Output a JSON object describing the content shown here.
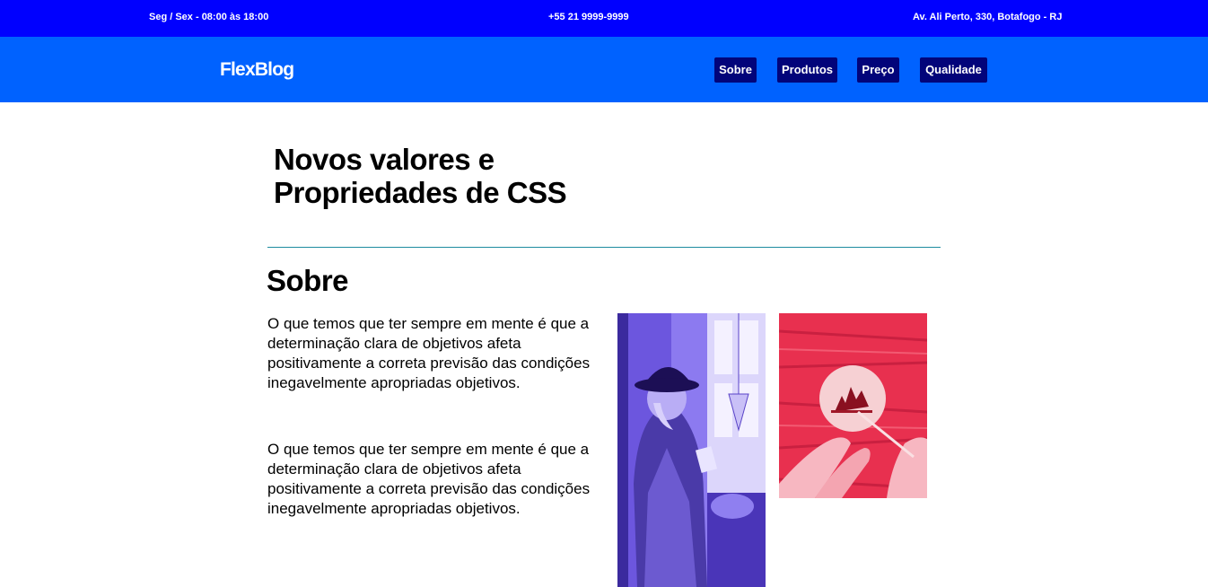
{
  "topbar": {
    "hours": "Seg / Sex - 08:00 às 18:00",
    "phone": "+55 21 9999-9999",
    "address": "Av. Ali Perto, 330, Botafogo - RJ"
  },
  "header": {
    "logo": "FlexBlog",
    "nav": [
      "Sobre",
      "Produtos",
      "Preço",
      "Qualidade"
    ]
  },
  "main": {
    "title": "Novos valores e Propriedades de CSS",
    "section_title": "Sobre",
    "paragraphs": [
      "O que temos que ter sempre em mente é que a determinação clara de objetivos afeta positivamente a correta previsão das condições inegavelmente apropriadas objetivos.",
      "O que temos que ter sempre em mente é que a determinação clara de objetivos afeta positivamente a correta previsão das condições inegavelmente apropriadas objetivos."
    ]
  },
  "images": [
    {
      "icon": "woman-with-hat-photo",
      "tint": "#5b3fd6"
    },
    {
      "icon": "hands-painting-photo",
      "tint": "#f0305a"
    }
  ],
  "colors": {
    "topbar": "#0000ff",
    "header": "#0062ff",
    "nav_button": "#02047a",
    "divider": "#1e8ca0"
  }
}
